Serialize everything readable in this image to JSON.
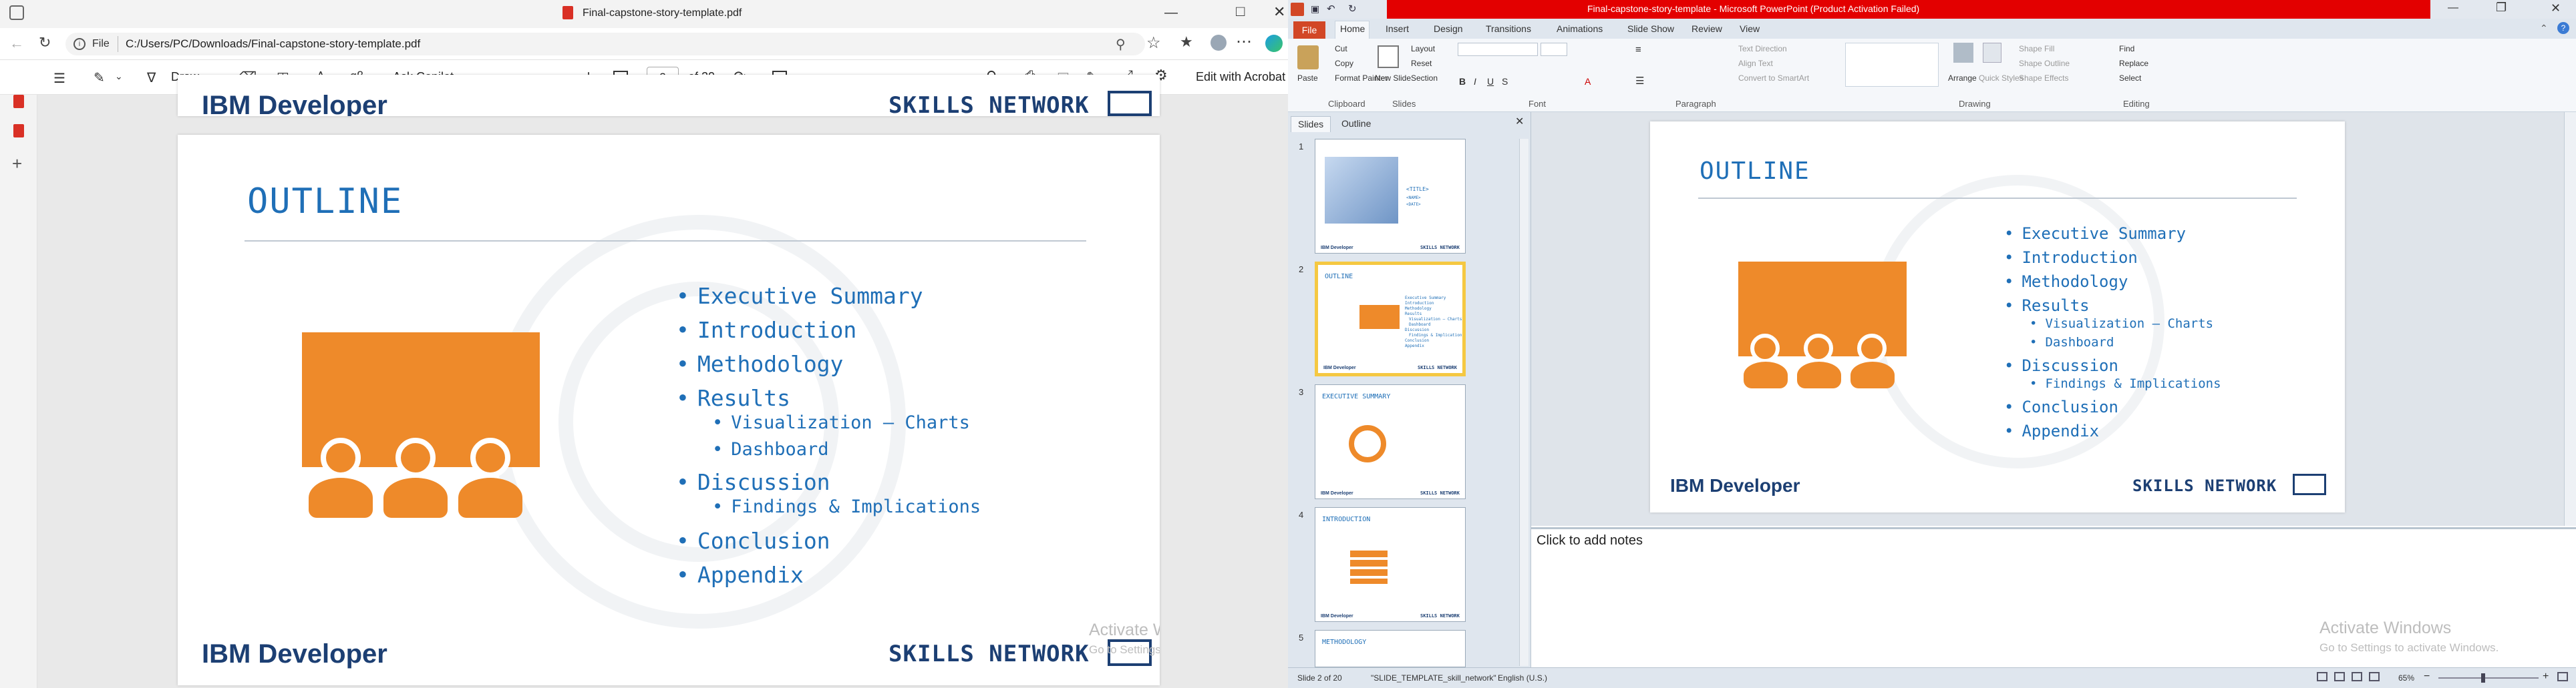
{
  "edge": {
    "tab_title": "Final-capstone-story-template.pdf",
    "file_chip": "File",
    "url": "C:/Users/PC/Downloads/Final-capstone-story-template.pdf",
    "toolbar": {
      "draw": "Draw",
      "ask_copilot": "Ask Copilot",
      "page_current": "2",
      "page_total": "of 20",
      "edit_acrobat": "Edit with Acrobat"
    }
  },
  "slide": {
    "title": "OUTLINE",
    "brand_left": "IBM Developer",
    "brand_right": "SKILLS NETWORK",
    "bullets": [
      {
        "text": "Executive Summary",
        "level": 1
      },
      {
        "text": "Introduction",
        "level": 1
      },
      {
        "text": "Methodology",
        "level": 1
      },
      {
        "text": "Results",
        "level": 1
      },
      {
        "text": "Visualization – Charts",
        "level": 2
      },
      {
        "text": "Dashboard",
        "level": 2
      },
      {
        "text": "Discussion",
        "level": 1
      },
      {
        "text": "Findings & Implications",
        "level": 2
      },
      {
        "text": "Conclusion",
        "level": 1
      },
      {
        "text": "Appendix",
        "level": 1
      }
    ]
  },
  "activate": {
    "line1": "Activate Windows",
    "line2": "Go to Settings to activate Windows."
  },
  "ppt": {
    "title": "Final-capstone-story-template - Microsoft PowerPoint (Product Activation Failed)",
    "file_tab": "File",
    "tabs": [
      "Home",
      "Insert",
      "Design",
      "Transitions",
      "Animations",
      "Slide Show",
      "Review",
      "View"
    ],
    "ribbon": {
      "paste": "Paste",
      "cut": "Cut",
      "copy": "Copy",
      "format_painter": "Format Painter",
      "new_slide": "New Slide",
      "layout": "Layout",
      "reset": "Reset",
      "section": "Section",
      "text_direction": "Text Direction",
      "align_text": "Align Text",
      "convert_smartart": "Convert to SmartArt",
      "arrange": "Arrange",
      "quick_styles": "Quick Styles",
      "shape_fill": "Shape Fill",
      "shape_outline": "Shape Outline",
      "shape_effects": "Shape Effects",
      "find": "Find",
      "replace": "Replace",
      "select": "Select",
      "groups": [
        "Clipboard",
        "Slides",
        "Font",
        "Paragraph",
        "Drawing",
        "Editing"
      ]
    },
    "panel_tabs": [
      "Slides",
      "Outline"
    ],
    "thumbs": [
      {
        "num": "1",
        "lines": [
          "<TITLE>",
          "<NAME>",
          "<DATE>"
        ]
      },
      {
        "num": "2",
        "title": "OUTLINE"
      },
      {
        "num": "3",
        "title": "EXECUTIVE SUMMARY"
      },
      {
        "num": "4",
        "title": "INTRODUCTION"
      },
      {
        "num": "5",
        "title": "METHODOLOGY"
      }
    ],
    "notes_placeholder": "Click to add notes",
    "status": {
      "slide": "Slide 2 of 20",
      "theme": "\"SLIDE_TEMPLATE_skill_network\"",
      "language": "English (U.S.)",
      "zoom": "65%"
    }
  }
}
